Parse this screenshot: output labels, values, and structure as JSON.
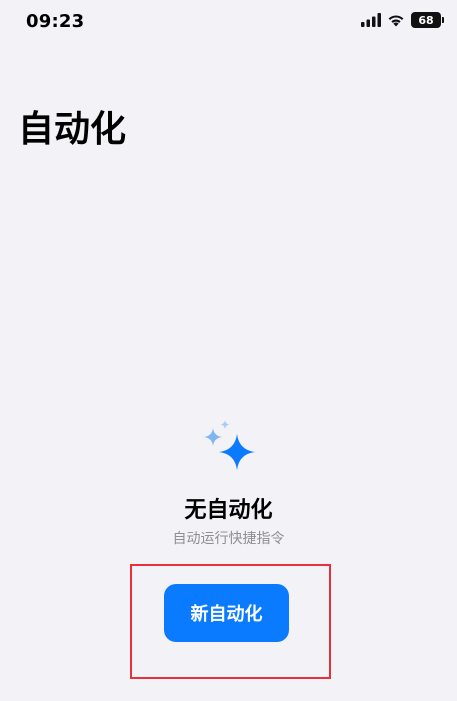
{
  "status_bar": {
    "time": "09:23",
    "battery_level": "68",
    "icons": [
      "cellular-signal-icon",
      "wifi-icon",
      "battery-icon"
    ]
  },
  "page": {
    "title": "自动化"
  },
  "empty_state": {
    "icon": "sparkle-icon",
    "title": "无自动化",
    "subtitle": "自动运行快捷指令"
  },
  "actions": {
    "new_automation_label": "新自动化"
  },
  "colors": {
    "background": "#f2f2f7",
    "accent": "#0a7aff",
    "highlight": "#e8303a"
  }
}
